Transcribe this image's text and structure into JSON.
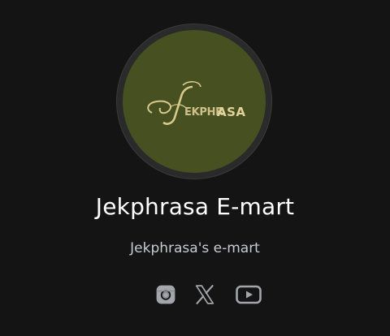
{
  "profile": {
    "logo_text": "JEKPHRASA",
    "title": "Jekphrasa E-mart",
    "subtitle": "Jekphrasa's e-mart"
  },
  "socials": [
    {
      "icon": "instagram-icon",
      "label": "Instagram"
    },
    {
      "icon": "x-icon",
      "label": "X"
    },
    {
      "icon": "youtube-icon",
      "label": "YouTube"
    }
  ],
  "colors": {
    "background": "#141414",
    "avatar_fill": "#465021",
    "logo_gold": "#d8c98c",
    "title": "#ffffff",
    "subtitle": "#c9cbd3",
    "icon": "#a3a5ab"
  }
}
